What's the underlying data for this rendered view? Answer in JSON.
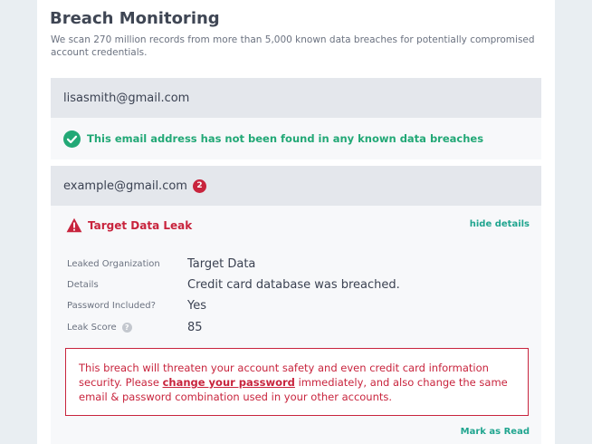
{
  "page": {
    "title": "Breach Monitoring",
    "description": "We scan 270 million records from more than 5,000 known data breaches for potentially compromised account credentials."
  },
  "accounts": [
    {
      "email": "lisasmith@gmail.com",
      "status_text": "This email address has not been found in any known data breaches",
      "status_icon": "check-circle-icon",
      "status_color": "#22a876"
    },
    {
      "email": "example@gmail.com",
      "breach_count": "2",
      "breach": {
        "icon": "warning-triangle-icon",
        "title": "Target Data Leak",
        "hide_details_label": "hide details",
        "details": [
          {
            "label": "Leaked Organization",
            "value": "Target Data"
          },
          {
            "label": "Details",
            "value": "Credit card database was breached."
          },
          {
            "label": "Password Included?",
            "value": "Yes"
          },
          {
            "label": "Leak Score",
            "value": "85",
            "help_icon": "question-icon",
            "help_glyph": "?"
          }
        ],
        "alert": {
          "text_before": "This breach will threaten your account safety and even credit card information security. Please ",
          "link_text": "change your password",
          "text_after": " immediately, and also change the same email & password combination used in your other accounts."
        },
        "mark_read_label": "Mark as Read"
      }
    }
  ],
  "colors": {
    "accent": "#20a58f",
    "danger": "#c8243d",
    "success": "#22a876"
  }
}
